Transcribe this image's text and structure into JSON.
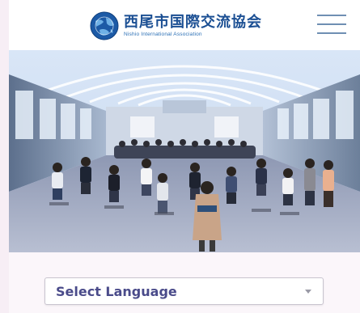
{
  "header": {
    "logo_title": "西尾市国際交流協会",
    "logo_subtitle": "Nishio International Association",
    "logo_icon": "globe-icon",
    "menu_icon": "hamburger-menu-icon"
  },
  "hero": {
    "image_subject": "group-photo"
  },
  "language": {
    "selected": "Select Language",
    "arrow_icon": "chevron-down-icon"
  },
  "colors": {
    "brand_blue": "#1b4f93",
    "page_background": "#f7eef5",
    "select_text": "#4a4b8a"
  }
}
